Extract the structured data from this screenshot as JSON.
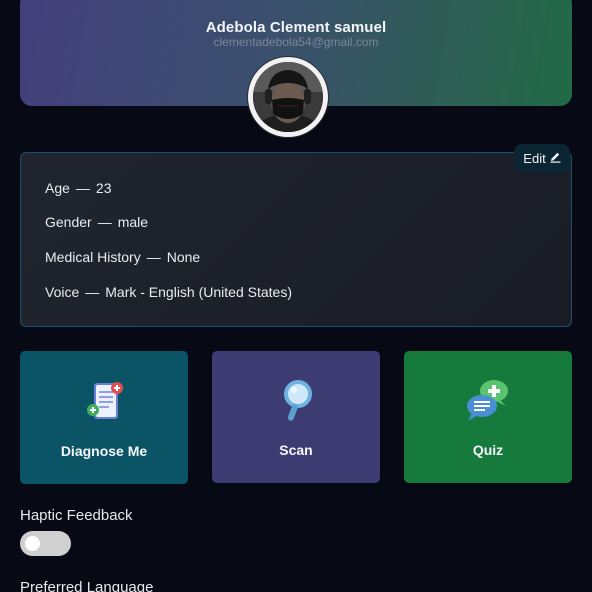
{
  "profile": {
    "name": "Adebola Clement samuel",
    "email": "clementadebola54@gmail.com"
  },
  "details": {
    "edit_label": "Edit",
    "separator": "—",
    "rows": [
      {
        "label": "Age",
        "value": "23"
      },
      {
        "label": "Gender",
        "value": "male"
      },
      {
        "label": "Medical History",
        "value": "None"
      },
      {
        "label": "Voice",
        "value": "Mark - English (United States)"
      }
    ]
  },
  "tiles": [
    {
      "label": "Diagnose Me",
      "color": "#0a5466",
      "icon": "medical-report-icon"
    },
    {
      "label": "Scan",
      "color": "#3c3c72",
      "icon": "magnifier-icon"
    },
    {
      "label": "Quiz",
      "color": "#167a3d",
      "icon": "chat-bubbles-icon"
    }
  ],
  "settings": {
    "haptic_label": "Haptic Feedback",
    "haptic_enabled": false,
    "language_label": "Preferred Language"
  }
}
